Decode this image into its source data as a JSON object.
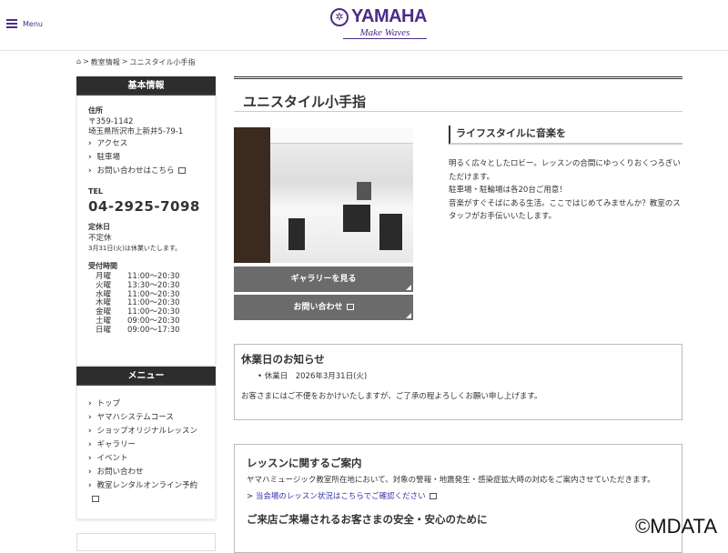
{
  "header": {
    "menu_label": "Menu",
    "logo_name": "YAMAHA",
    "logo_tagline": "Make Waves"
  },
  "breadcrumb": [
    "教室情報",
    "ユニスタイル小手指"
  ],
  "info": {
    "heading": "基本情報",
    "address_label": "住所",
    "postal": "〒359-1142",
    "address": "埼玉県所沢市上新井5-79-1",
    "links": [
      "アクセス",
      "駐車場",
      "お問い合わせはこちら"
    ],
    "tel_label": "TEL",
    "tel": "04-2925-7098",
    "closed_label": "定休日",
    "closed": "不定休",
    "closed_note": "3月31日(火)は休業いたします。",
    "hours_label": "受付時間",
    "hours": [
      {
        "day": "月曜",
        "time": "11:00〜20:30"
      },
      {
        "day": "火曜",
        "time": "13:30〜20:30"
      },
      {
        "day": "水曜",
        "time": "11:00〜20:30"
      },
      {
        "day": "木曜",
        "time": "11:00〜20:30"
      },
      {
        "day": "金曜",
        "time": "11:00〜20:30"
      },
      {
        "day": "土曜",
        "time": "09:00〜20:30"
      },
      {
        "day": "日曜",
        "time": "09:00〜17:30"
      }
    ]
  },
  "menu": {
    "heading": "メニュー",
    "items": [
      "トップ",
      "ヤマハシステムコース",
      "ショップオリジナルレッスン",
      "ギャラリー",
      "イベント",
      "お問い合わせ",
      "教室レンタルオンライン予約"
    ]
  },
  "main": {
    "title": "ユニスタイル小手指",
    "gallery_button": "ギャラリーを見る",
    "contact_button": "お問い合わせ",
    "subheading": "ライフスタイルに音楽を",
    "desc": [
      "明るく広々としたロビー。レッスンの合間にゆっくりおくつろぎいただけます。",
      "駐車場・駐輪場は各20台ご用意！",
      "音楽がすぐそばにある生活。ここではじめてみませんか？教室のスタッフがお手伝いいたします。"
    ],
    "notice": {
      "title": "休業日のお知らせ",
      "item": "休業日　2026年3月31日(火)",
      "text": "お客さまにはご不便をおかけいたしますが、ご了承の程よろしくお願い申し上げます。"
    },
    "lesson": {
      "title": "レッスンに関するご案内",
      "text": "ヤマハミュージック教室所在地において、対象の警報・地震発生・感染症拡大時の対応をご案内させていただきます。",
      "link": "当会場のレッスン状況はこちらでご確認ください",
      "title2": "ご来店ご来場されるお客さまの安全・安心のために"
    }
  },
  "watermark": "©MDATA"
}
